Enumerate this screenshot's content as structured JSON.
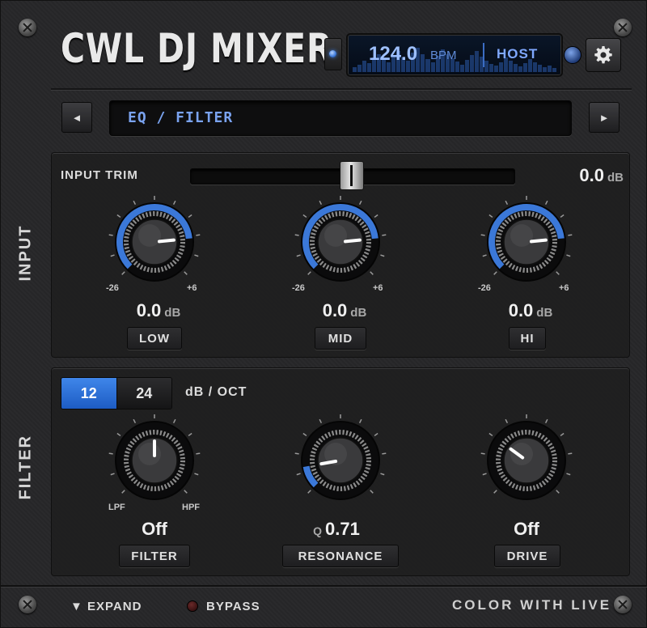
{
  "app": {
    "title": "CWL DJ MIXER"
  },
  "bpm": {
    "value": "124.0",
    "unit": "BPM",
    "source": "HOST"
  },
  "preset": {
    "name": "EQ / FILTER",
    "prev_label": "◄",
    "next_label": "►"
  },
  "input": {
    "section_label": "INPUT",
    "trim": {
      "label": "INPUT TRIM",
      "value": "0.0",
      "unit": "dB",
      "level": 0.5
    },
    "knobs": [
      {
        "label": "LOW",
        "value": "0.0",
        "unit": "dB",
        "min_label": "-26",
        "max_label": "+6",
        "level": 0.8125
      },
      {
        "label": "MID",
        "value": "0.0",
        "unit": "dB",
        "min_label": "-26",
        "max_label": "+6",
        "level": 0.8125
      },
      {
        "label": "HI",
        "value": "0.0",
        "unit": "dB",
        "min_label": "-26",
        "max_label": "+6",
        "level": 0.8125
      }
    ]
  },
  "filter": {
    "section_label": "FILTER",
    "slope": {
      "options": [
        "12",
        "24"
      ],
      "selected": "12",
      "unit_label": "dB / OCT"
    },
    "knobs": [
      {
        "label": "FILTER",
        "value": "Off",
        "min_label": "LPF",
        "max_label": "HPF",
        "level": 0.5
      },
      {
        "label": "RESONANCE",
        "prefix": "Q",
        "value": "0.71",
        "level": 0.13
      },
      {
        "label": "DRIVE",
        "value": "Off",
        "level": 0.3
      }
    ]
  },
  "footer": {
    "expand_label": "▼ EXPAND",
    "bypass_label": "BYPASS",
    "brand": "COLOR WITH LIVE"
  },
  "colors": {
    "accent": "#3b78d8",
    "panel": "#2a2a2c",
    "text": "#e6e6e6"
  }
}
